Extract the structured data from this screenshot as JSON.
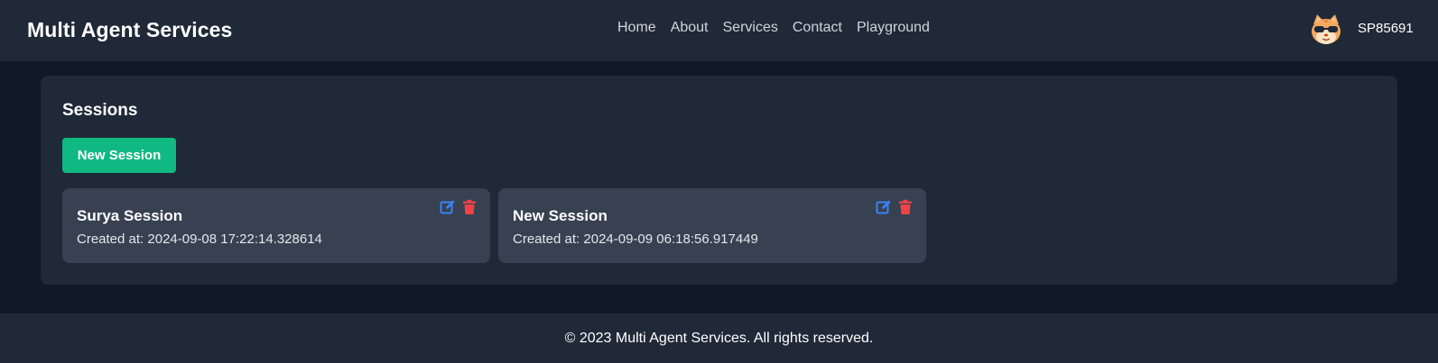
{
  "header": {
    "brand": "Multi Agent Services",
    "nav": [
      "Home",
      "About",
      "Services",
      "Contact",
      "Playground"
    ],
    "username": "SP85691",
    "avatar_icon": "cat-avatar-with-sunglasses"
  },
  "sessions": {
    "title": "Sessions",
    "new_button_label": "New Session",
    "created_prefix": "Created at:",
    "items": [
      {
        "name": "Surya Session",
        "created_at": "2024-09-08 17:22:14.328614"
      },
      {
        "name": "New Session",
        "created_at": "2024-09-09 06:18:56.917449"
      }
    ],
    "edit_icon": "edit-icon",
    "delete_icon": "trash-icon"
  },
  "footer": {
    "text": "© 2023 Multi Agent Services. All rights reserved."
  },
  "colors": {
    "page_bg": "#111827",
    "surface": "#1f2937",
    "card": "#374151",
    "accent_green": "#10b981",
    "edit_blue": "#3b82f6",
    "delete_red": "#ef4444"
  }
}
